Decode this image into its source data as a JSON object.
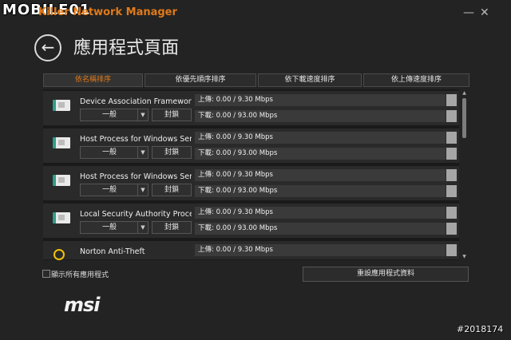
{
  "watermark": "MOBILE01",
  "app_title": "Killer Network Manager",
  "window_controls": [
    "minimize-icon",
    "close-icon"
  ],
  "page_title": "應用程式頁面",
  "sort_tabs": [
    {
      "label": "依名稱排序",
      "active": true
    },
    {
      "label": "依優先順序排序",
      "active": false
    },
    {
      "label": "依下載速度排序",
      "active": false
    },
    {
      "label": "依上傳速度排序",
      "active": false
    }
  ],
  "apps": [
    {
      "name": "Device Association Framework ...",
      "priority": "一般",
      "block": "封鎖",
      "upload": "上傳: 0.00 / 9.30 Mbps",
      "download": "下載: 0.00 / 93.00 Mbps",
      "icon": "application-window-icon"
    },
    {
      "name": "Host Process for Windows Serv...",
      "priority": "一般",
      "block": "封鎖",
      "upload": "上傳: 0.00 / 9.30 Mbps",
      "download": "下載: 0.00 / 93.00 Mbps",
      "icon": "application-window-icon"
    },
    {
      "name": "Host Process for Windows Serv...",
      "priority": "一般",
      "block": "封鎖",
      "upload": "上傳: 0.00 / 9.30 Mbps",
      "download": "下載: 0.00 / 93.00 Mbps",
      "icon": "application-window-icon"
    },
    {
      "name": "Local Security Authority Process",
      "priority": "一般",
      "block": "封鎖",
      "upload": "上傳: 0.00 / 9.30 Mbps",
      "download": "下載: 0.00 / 93.00 Mbps",
      "icon": "application-window-icon"
    },
    {
      "name": "Norton Anti-Theft",
      "upload": "上傳: 0.00 / 9.30 Mbps",
      "icon": "location-pin-icon"
    }
  ],
  "show_all_label": "顯示所有應用程式",
  "reset_label": "重設應用程式資料",
  "brand": "msi",
  "ref_id": "#2018174",
  "colors": {
    "accent": "#e07a18",
    "background": "#232323"
  }
}
